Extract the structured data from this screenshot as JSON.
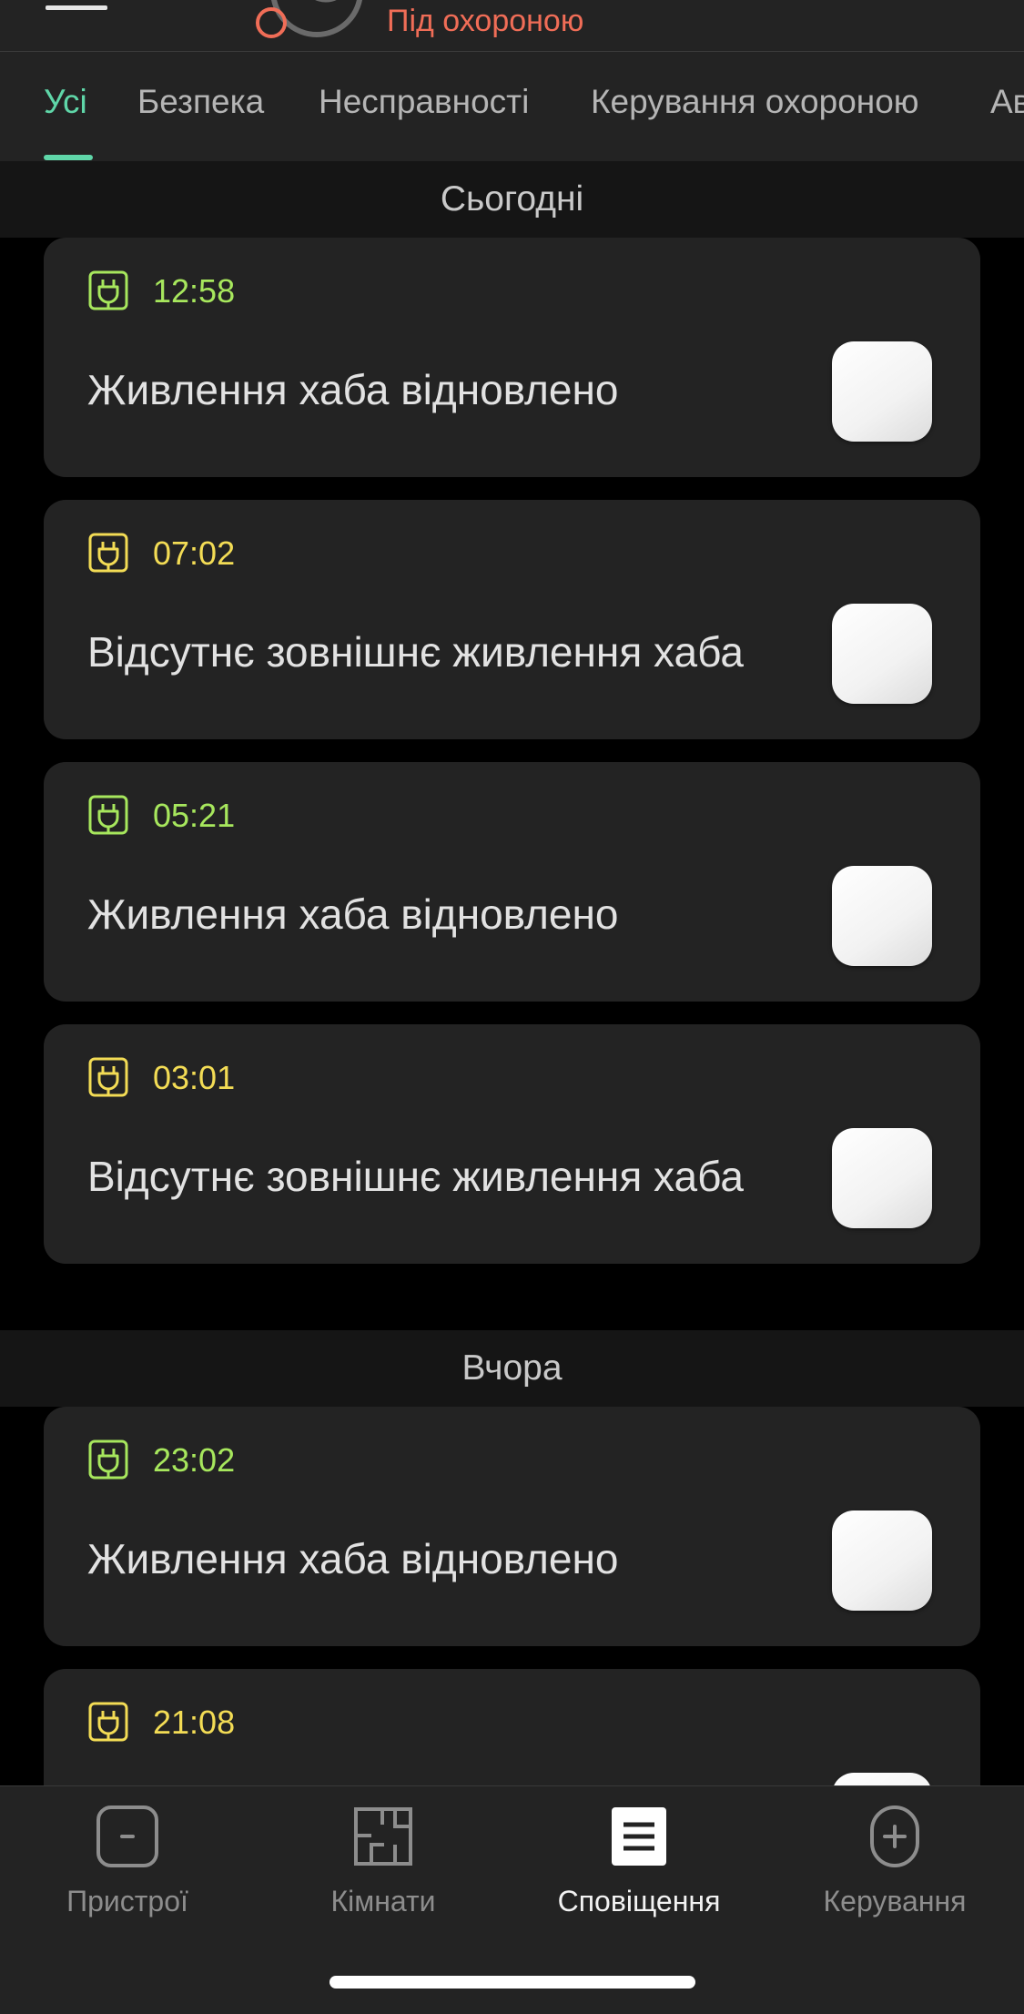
{
  "header": {
    "status": "Під охороною",
    "status_color": "#f06d57"
  },
  "tabs": [
    {
      "label": "Усі",
      "active": true
    },
    {
      "label": "Безпека",
      "active": false
    },
    {
      "label": "Несправності",
      "active": false
    },
    {
      "label": "Керування охороною",
      "active": false
    },
    {
      "label": "Ав",
      "active": false
    }
  ],
  "sections": [
    {
      "title": "Сьогодні",
      "events": [
        {
          "time": "12:58",
          "title": "Живлення хаба відновлено",
          "status": "restored",
          "icon": "power-plug-icon"
        },
        {
          "time": "07:02",
          "title": "Відсутнє зовнішнє живлення хаба",
          "status": "warning",
          "icon": "power-plug-icon"
        },
        {
          "time": "05:21",
          "title": "Живлення хаба відновлено",
          "status": "restored",
          "icon": "power-plug-icon"
        },
        {
          "time": "03:01",
          "title": "Відсутнє зовнішнє живлення хаба",
          "status": "warning",
          "icon": "power-plug-icon"
        }
      ]
    },
    {
      "title": "Вчора",
      "events": [
        {
          "time": "23:02",
          "title": "Живлення хаба відновлено",
          "status": "restored",
          "icon": "power-plug-icon"
        },
        {
          "time": "21:08",
          "title": "",
          "status": "warning",
          "icon": "power-plug-icon"
        }
      ]
    }
  ],
  "bottom_nav": [
    {
      "label": "Пристрої",
      "icon": "devices-icon",
      "active": false
    },
    {
      "label": "Кімнати",
      "icon": "rooms-icon",
      "active": false
    },
    {
      "label": "Сповіщення",
      "icon": "notifications-icon",
      "active": true
    },
    {
      "label": "Керування",
      "icon": "control-icon",
      "active": false
    }
  ],
  "colors": {
    "accent": "#5fd6a8",
    "restored": "#a7e75d",
    "warning": "#f3dc55",
    "armed": "#f06d57",
    "card_bg": "#232323"
  }
}
